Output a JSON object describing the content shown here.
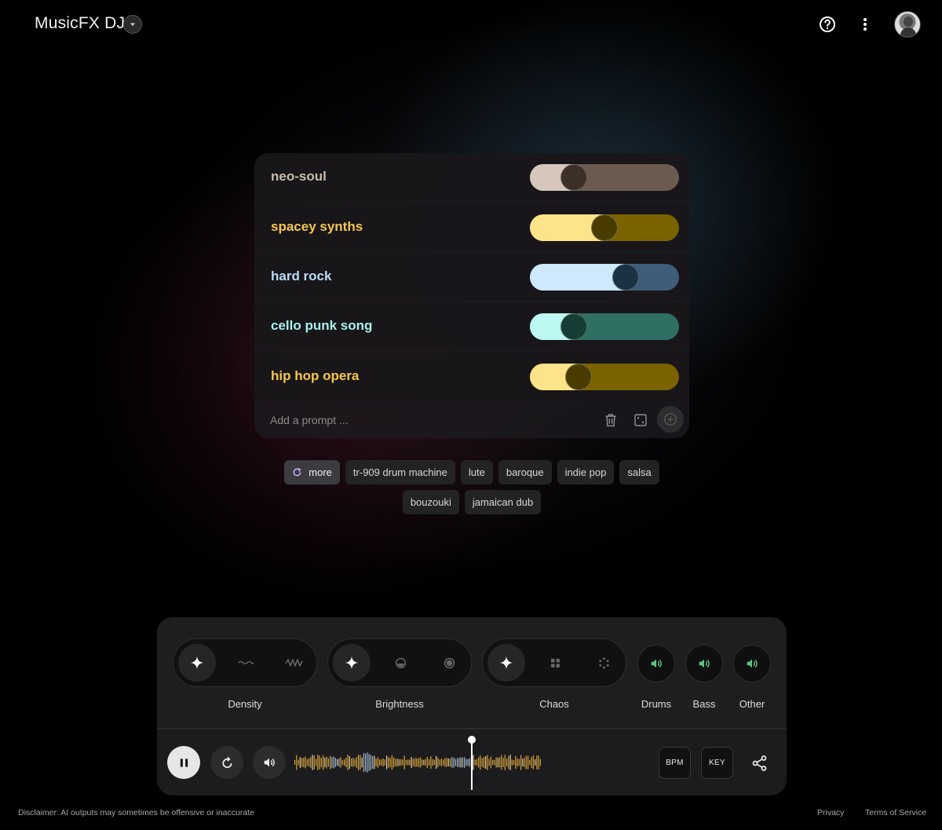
{
  "header": {
    "title": "MusicFX DJ"
  },
  "prompts": [
    {
      "label": "neo-soul",
      "value": 0.25,
      "color": "#c9bcb0",
      "fill": "#d6c7bb",
      "track": "#6b5b4f",
      "knob": "#3b2f27"
    },
    {
      "label": "spacey synths",
      "value": 0.5,
      "color": "#f5c84a",
      "fill": "#fde38a",
      "track": "#7a6300",
      "knob": "#4a3c00"
    },
    {
      "label": "hard rock",
      "value": 0.67,
      "color": "#b8dcf5",
      "fill": "#cde9fb",
      "track": "#3f5d78",
      "knob": "#1b3244"
    },
    {
      "label": "cello punk song",
      "value": 0.25,
      "color": "#a8f1ea",
      "fill": "#bdf8f2",
      "track": "#2f6e63",
      "knob": "#153d35"
    },
    {
      "label": "hip hop opera",
      "value": 0.29,
      "color": "#f5c84a",
      "fill": "#fde38a",
      "track": "#7a6300",
      "knob": "#4a3c00"
    }
  ],
  "add_prompt": {
    "placeholder": "Add a prompt ..."
  },
  "chips": {
    "more_label": "more",
    "items": [
      "tr-909 drum machine",
      "lute",
      "baroque",
      "indie pop",
      "salsa",
      "bouzouki",
      "jamaican dub"
    ]
  },
  "controls": {
    "density_label": "Density",
    "brightness_label": "Brightness",
    "chaos_label": "Chaos",
    "drums_label": "Drums",
    "bass_label": "Bass",
    "other_label": "Other",
    "stem_color": "#5cc281",
    "bpm_label": "BPM",
    "key_label": "KEY"
  },
  "footer": {
    "disclaimer": "Disclaimer: AI outputs may sometimes be offensive or inaccurate",
    "privacy": "Privacy",
    "terms": "Terms of Service"
  }
}
